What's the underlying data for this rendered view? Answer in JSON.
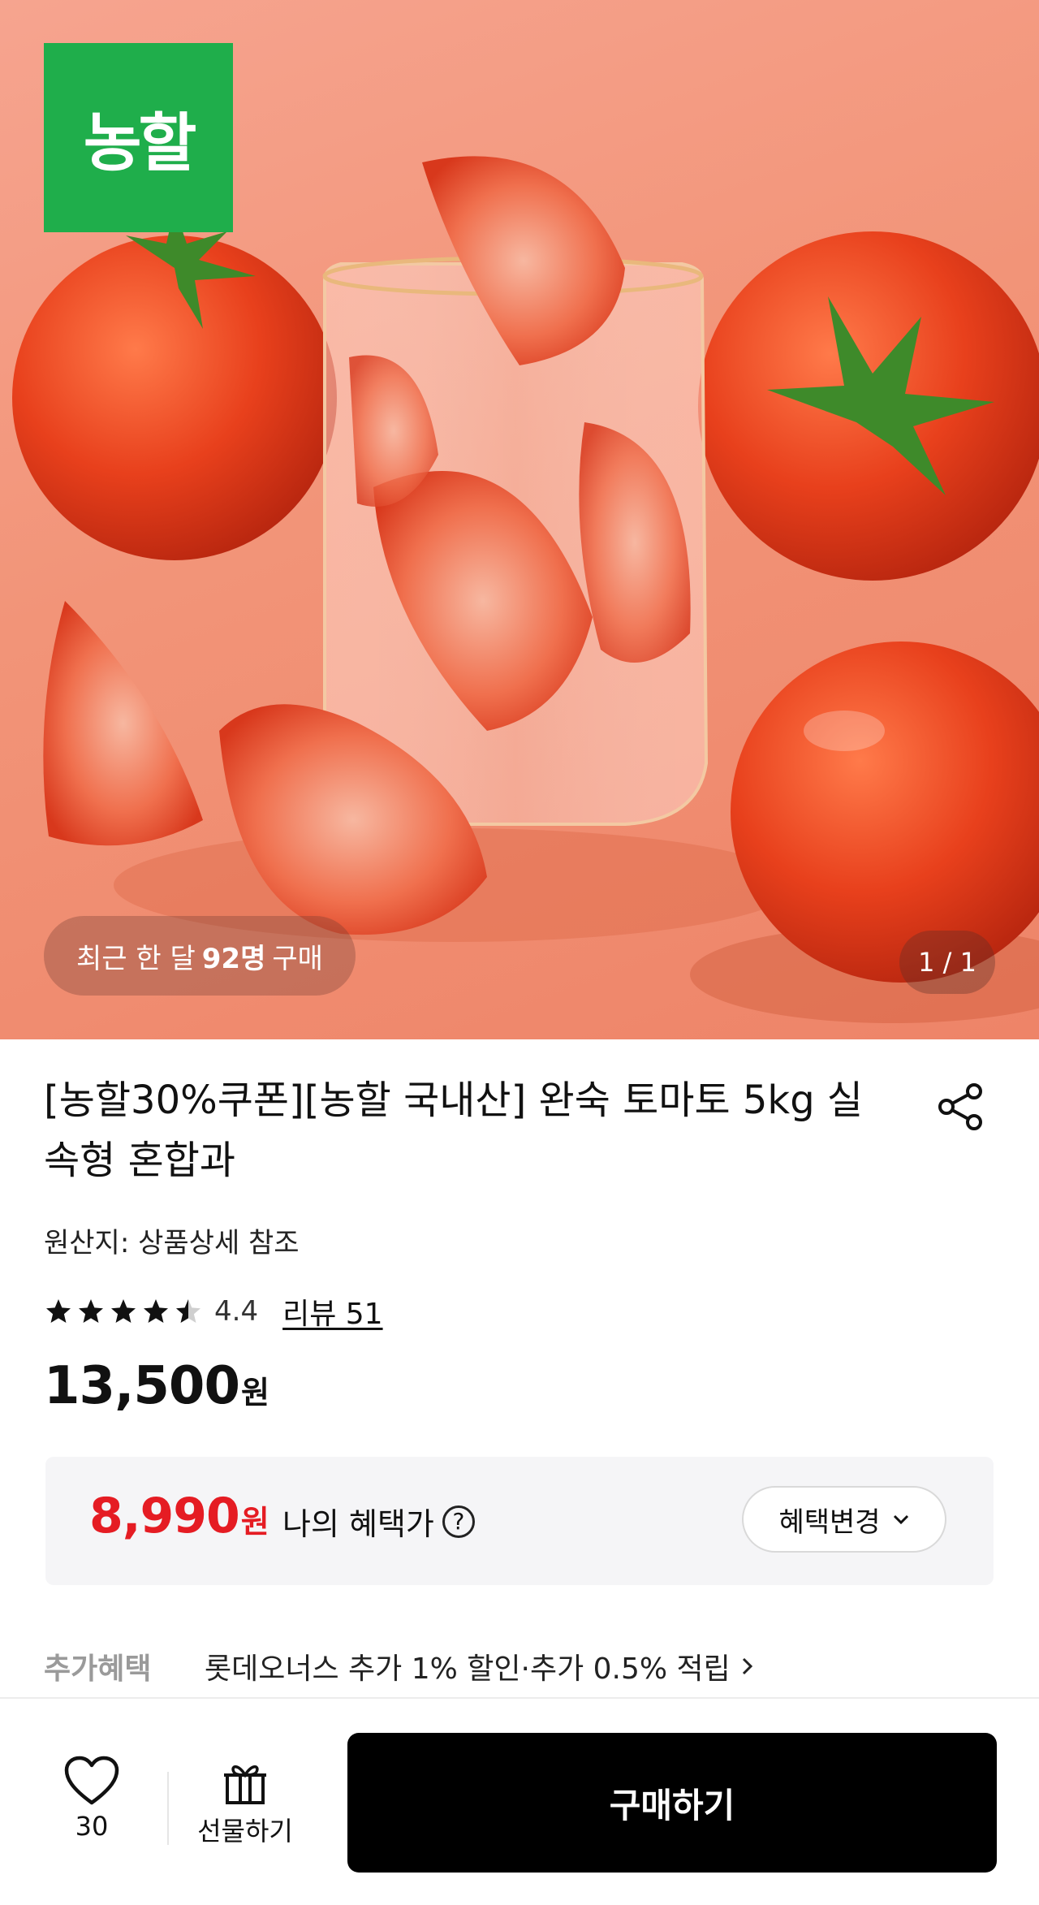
{
  "hero": {
    "brand_logo_text": "농할",
    "recent_buyers": {
      "prefix": "최근 한 달",
      "count": "92명",
      "suffix": "구매"
    },
    "image_counter": "1 / 1"
  },
  "product": {
    "title": "[농할30%쿠폰][농할 국내산] 완숙 토마토 5kg 실속형 혼합과",
    "origin": "원산지: 상품상세 참조",
    "rating": 4.4,
    "rating_text": "4.4",
    "review_link": "리뷰 51",
    "price": "13,500",
    "price_unit": "원"
  },
  "benefit": {
    "price": "8,990",
    "price_unit": "원",
    "label": "나의 혜택가",
    "help_icon": "?",
    "change_button": "혜택변경"
  },
  "extra": {
    "label": "추가혜택",
    "text": "롯데오너스 추가 1% 할인·추가 0.5% 적립"
  },
  "bottom_bar": {
    "like_count": "30",
    "gift_label": "선물하기",
    "buy_label": "구매하기"
  },
  "colors": {
    "brand_green": "#1fae4b",
    "benefit_red": "#e51c23",
    "buy_button": "#000000"
  }
}
